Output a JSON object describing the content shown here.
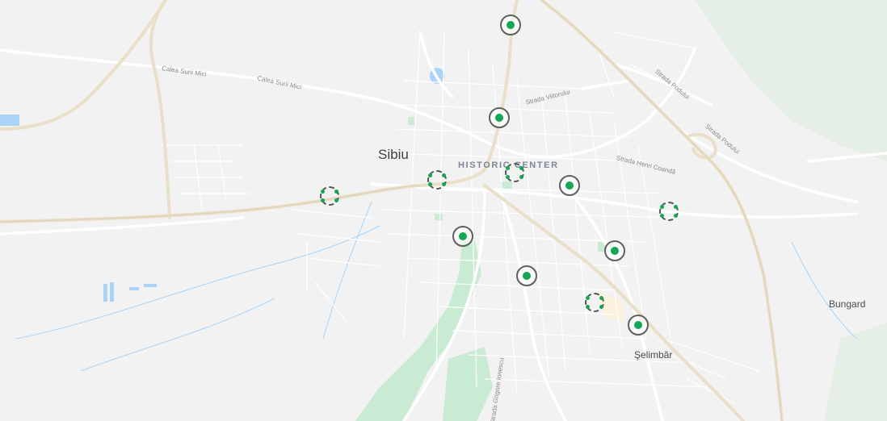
{
  "map": {
    "labels": {
      "city": "Sibiu",
      "district": "HISTORIC CENTER",
      "village_east": "Bungard",
      "village_south": "Şelimbăr",
      "street_calea_surii_1": "Calea Surii Mici",
      "street_calea_surii_2": "Calea Surii Mici",
      "street_viitorului": "Strada Viitorului",
      "street_podului_1": "Strada Podului",
      "street_podului_2": "Strada Podului",
      "street_henri_coanda": "Strada Henri Coandă",
      "street_grigore_ionescu": "Strada Grigore Ionescu"
    },
    "colors": {
      "land": "#f2f2f2",
      "road": "#ffffff",
      "highway": "#eadfc8",
      "park": "#c9ebd3",
      "water": "#aad3f5",
      "marker_fill": "#13a654",
      "marker_ring": "#5f5f5f"
    },
    "markers": [
      {
        "id": "m1",
        "style": "solid",
        "icon": "ring-dot-icon"
      },
      {
        "id": "m2",
        "style": "solid",
        "icon": "ring-dot-icon"
      },
      {
        "id": "m3",
        "style": "dashed",
        "icon": "dashed-ring-icon"
      },
      {
        "id": "m4",
        "style": "dashed",
        "icon": "dashed-ring-icon"
      },
      {
        "id": "m5",
        "style": "dashed",
        "icon": "dashed-ring-icon"
      },
      {
        "id": "m6",
        "style": "solid",
        "icon": "ring-dot-icon"
      },
      {
        "id": "m7",
        "style": "dashed",
        "icon": "dashed-ring-icon"
      },
      {
        "id": "m8",
        "style": "solid",
        "icon": "ring-dot-icon"
      },
      {
        "id": "m9",
        "style": "solid",
        "icon": "ring-dot-icon"
      },
      {
        "id": "m10",
        "style": "solid",
        "icon": "ring-dot-icon"
      },
      {
        "id": "m11",
        "style": "dashed",
        "icon": "dashed-ring-icon"
      },
      {
        "id": "m12",
        "style": "solid",
        "icon": "ring-dot-icon"
      }
    ]
  }
}
